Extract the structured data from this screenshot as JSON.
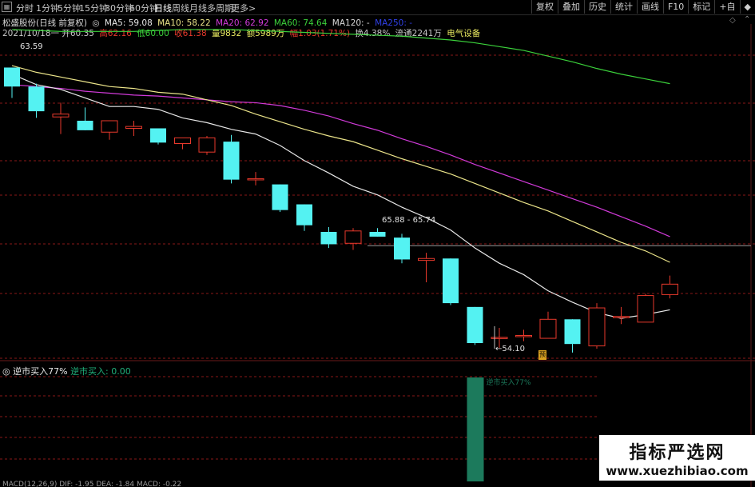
{
  "toolbar": {
    "periods": [
      "分时",
      "1分钟",
      "5分钟",
      "15分钟",
      "30分钟",
      "60分钟",
      "日线",
      "周线",
      "月线",
      "多周期",
      "更多>"
    ],
    "right_tools": [
      "复权",
      "叠加",
      "历史",
      "统计",
      "画线",
      "F10",
      "标记",
      "+自",
      "◆"
    ]
  },
  "ma_row": {
    "stock": "松盛股份(日线 前复权)",
    "ma5": "MA5: 59.08",
    "ma10": "MA10: 58.22",
    "ma20": "MA20: 62.92",
    "ma60": "MA60: 74.64",
    "ma120": "MA120: -",
    "ma250": "MA250: -"
  },
  "info_row": {
    "date": "2021/10/18",
    "dash": "一",
    "open": "开60.35",
    "high": "高62.16",
    "low": "低60.00",
    "close": "收61.38",
    "volume": "量9832",
    "amount": "额5989万",
    "change": "幅1.03(1.71%)",
    "turnover": "换4.38%",
    "float": "流通2241万",
    "sector": "电气设备"
  },
  "chart_labels": {
    "high_mark": "63.59",
    "low_mark": "54.10",
    "gap_mark": "65.88 - 65.74",
    "signal": "预"
  },
  "indicator": {
    "name": "逆市买入77%",
    "value": "逆市买入: 0.00",
    "bar_label": "逆市买入77%"
  },
  "bottom_row": "MACD(12,26,9) DIF: -1.95 DEA: -1.84 MACD: -0.22",
  "watermark": {
    "title": "指标严选网",
    "url": "www.xuezhibiao.com"
  },
  "colors": {
    "up": "#e8392c",
    "down": "#54f2f2",
    "ma5": "#e8e8e8",
    "ma10": "#ece58a",
    "ma20": "#d13ad9",
    "ma60": "#3bd13b",
    "grid": "#8a1818",
    "bar": "#1c7a5c"
  },
  "chart_data": {
    "type": "candlestick",
    "candles": [
      {
        "o": 63.6,
        "h": 63.6,
        "l": 60.4,
        "c": 61.6
      },
      {
        "o": 61.6,
        "h": 61.9,
        "l": 58.3,
        "c": 59.0
      },
      {
        "o": 58.4,
        "h": 59.9,
        "l": 56.6,
        "c": 58.7
      },
      {
        "o": 58.0,
        "h": 59.4,
        "l": 57.0,
        "c": 57.0
      },
      {
        "o": 56.8,
        "h": 58.0,
        "l": 56.0,
        "c": 58.0
      },
      {
        "o": 57.2,
        "h": 58.0,
        "l": 56.4,
        "c": 57.4
      },
      {
        "o": 57.2,
        "h": 57.2,
        "l": 55.5,
        "c": 55.7
      },
      {
        "o": 55.6,
        "h": 56.2,
        "l": 55.0,
        "c": 56.2
      },
      {
        "o": 54.7,
        "h": 56.4,
        "l": 54.4,
        "c": 56.2
      },
      {
        "o": 55.8,
        "h": 56.5,
        "l": 51.4,
        "c": 51.8
      },
      {
        "o": 51.9,
        "h": 52.6,
        "l": 51.2,
        "c": 51.9
      },
      {
        "o": 51.3,
        "h": 51.3,
        "l": 48.4,
        "c": 48.6
      },
      {
        "o": 49.2,
        "h": 49.2,
        "l": 46.4,
        "c": 47.0
      },
      {
        "o": 46.3,
        "h": 46.8,
        "l": 44.6,
        "c": 45.0
      },
      {
        "o": 45.1,
        "h": 46.7,
        "l": 44.4,
        "c": 46.4
      },
      {
        "o": 46.3,
        "h": 46.7,
        "l": 45.8,
        "c": 45.8
      },
      {
        "o": 45.7,
        "h": 46.1,
        "l": 43.0,
        "c": 43.4
      },
      {
        "o": 43.3,
        "h": 44.1,
        "l": 41.0,
        "c": 43.5
      },
      {
        "o": 43.5,
        "h": 43.5,
        "l": 38.6,
        "c": 38.8
      },
      {
        "o": 38.4,
        "h": 38.4,
        "l": 34.4,
        "c": 34.6
      },
      {
        "o": 35.2,
        "h": 36.2,
        "l": 34.1,
        "c": 35.2
      },
      {
        "o": 35.4,
        "h": 36.0,
        "l": 34.8,
        "c": 35.4
      },
      {
        "o": 35.1,
        "h": 37.9,
        "l": 35.1,
        "c": 37.1
      },
      {
        "o": 37.1,
        "h": 37.1,
        "l": 33.6,
        "c": 34.5
      },
      {
        "o": 34.3,
        "h": 38.8,
        "l": 34.0,
        "c": 38.3
      },
      {
        "o": 37.4,
        "h": 38.4,
        "l": 36.6,
        "c": 37.4
      },
      {
        "o": 36.8,
        "h": 39.8,
        "l": 36.8,
        "c": 39.6
      },
      {
        "o": 39.7,
        "h": 41.7,
        "l": 39.3,
        "c": 40.8
      }
    ],
    "ma5": [
      62.9,
      61.8,
      61.3,
      60.4,
      59.5,
      59.5,
      59.2,
      58.3,
      57.8,
      57.1,
      56.6,
      55.4,
      53.8,
      52.5,
      51.1,
      50.2,
      48.9,
      47.8,
      46.5,
      44.6,
      43.0,
      41.8,
      40.1,
      38.9,
      37.8,
      37.2,
      37.6,
      38.1
    ],
    "ma10": [
      63.8,
      63.1,
      62.6,
      62.1,
      61.6,
      61.4,
      61.0,
      60.8,
      60.2,
      59.6,
      58.7,
      57.9,
      57.1,
      56.4,
      55.8,
      54.9,
      54.0,
      53.2,
      52.4,
      51.4,
      50.4,
      49.4,
      48.5,
      47.4,
      46.3,
      45.2,
      44.3,
      43.1
    ],
    "ma20": [
      61.8,
      61.6,
      61.4,
      61.1,
      60.9,
      60.7,
      60.6,
      60.4,
      60.2,
      60.0,
      59.9,
      59.6,
      59.1,
      58.5,
      57.7,
      57.0,
      56.1,
      55.3,
      54.4,
      53.4,
      52.5,
      51.6,
      50.7,
      49.8,
      48.9,
      47.9,
      46.9,
      45.8
    ],
    "ma60": [
      67.6,
      67.5,
      67.4,
      67.4,
      67.4,
      67.4,
      67.5,
      67.6,
      67.6,
      67.6,
      67.5,
      67.4,
      67.3,
      67.2,
      67.1,
      67.0,
      66.9,
      66.7,
      66.5,
      66.2,
      65.8,
      65.4,
      64.8,
      64.2,
      63.5,
      62.9,
      62.4,
      61.9
    ],
    "indicator_bar": {
      "index": 19,
      "value": 77
    },
    "ylim": [
      33.0,
      66.5
    ]
  }
}
